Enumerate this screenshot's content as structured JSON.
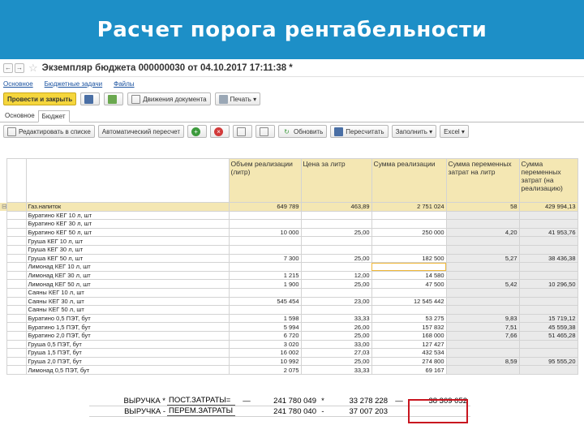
{
  "slide": {
    "title": "Расчет порога рентабельности"
  },
  "window": {
    "title": "Экземпляр бюджета 000000030 от 04.10.2017 17:11:38 *",
    "links": [
      "Основное",
      "Бюджетные задачи",
      "Файлы"
    ],
    "toolbar": {
      "post_close": "Провести и закрыть",
      "drive_docs": "Движения документа",
      "print": "Печать"
    },
    "tabs": [
      "Основное",
      "Бюджет"
    ],
    "grid_toolbar": {
      "edit_list": "Редактировать в списке",
      "auto_recalc": "Автоматический пересчет",
      "refresh": "Обновить",
      "recalc": "Пересчитать",
      "fill": "Заполнить",
      "excel": "Excel"
    }
  },
  "table": {
    "columns": [
      "",
      "Объем реализации (литр)",
      "Цена за литр",
      "Сумма реализации",
      "Сумма переменных затрат на литр",
      "Сумма переменных затрат (на реализацию)"
    ],
    "rows": [
      {
        "name": "Газ.напиток",
        "vol": "649 789",
        "price": "463,89",
        "sum": "2 751 024",
        "var_per": "58",
        "var_total": "429 994,13",
        "group": true
      },
      {
        "name": "Буратино КЕГ 10 л, шт",
        "vol": "",
        "price": "",
        "sum": "",
        "var_per": "",
        "var_total": ""
      },
      {
        "name": "Буратино КЕГ 30 л, шт",
        "vol": "",
        "price": "",
        "sum": "",
        "var_per": "",
        "var_total": ""
      },
      {
        "name": "Буратино КЕГ 50 л, шт",
        "vol": "10 000",
        "price": "25,00",
        "sum": "250 000",
        "var_per": "4,20",
        "var_total": "41 953,76"
      },
      {
        "name": "Груша КЕГ 10 л, шт",
        "vol": "",
        "price": "",
        "sum": "",
        "var_per": "",
        "var_total": ""
      },
      {
        "name": "Груша КЕГ 30 л, шт",
        "vol": "",
        "price": "",
        "sum": "",
        "var_per": "",
        "var_total": ""
      },
      {
        "name": "Груша КЕГ 50 л, шт",
        "vol": "7 300",
        "price": "25,00",
        "sum": "182 500",
        "var_per": "5,27",
        "var_total": "38 436,38"
      },
      {
        "name": "Лимонад КЕГ 10 л, шт",
        "vol": "",
        "price": "",
        "sum": "",
        "var_per": "",
        "var_total": "",
        "sel": true
      },
      {
        "name": "Лимонад КЕГ 30 л, шт",
        "vol": "1 215",
        "price": "12,00",
        "sum": "14 580",
        "var_per": "",
        "var_total": ""
      },
      {
        "name": "Лимонад КЕГ 50 л, шт",
        "vol": "1 900",
        "price": "25,00",
        "sum": "47 500",
        "var_per": "5,42",
        "var_total": "10 296,50"
      },
      {
        "name": "Саяны КЕГ 10 л, шт",
        "vol": "",
        "price": "",
        "sum": "",
        "var_per": "",
        "var_total": ""
      },
      {
        "name": "Саяны КЕГ 30 л, шт",
        "vol": "545 454",
        "price": "23,00",
        "sum": "12 545 442",
        "var_per": "",
        "var_total": ""
      },
      {
        "name": "Саяны КЕГ 50 л, шт",
        "vol": "",
        "price": "",
        "sum": "",
        "var_per": "",
        "var_total": ""
      },
      {
        "name": "Буратино 0,5 ПЭТ, бут",
        "vol": "1 598",
        "price": "33,33",
        "sum": "53 275",
        "var_per": "9,83",
        "var_total": "15 719,12"
      },
      {
        "name": "Буратино 1,5 ПЭТ, бут",
        "vol": "5 994",
        "price": "26,00",
        "sum": "157 832",
        "var_per": "7,51",
        "var_total": "45 559,38"
      },
      {
        "name": "Буратино 2,0 ПЭТ, бут",
        "vol": "6 720",
        "price": "25,00",
        "sum": "168 000",
        "var_per": "7,66",
        "var_total": "51 465,28"
      },
      {
        "name": "Груша 0,5 ПЭТ, бут",
        "vol": "3 020",
        "price": "33,00",
        "sum": "127 427",
        "var_per": "",
        "var_total": ""
      },
      {
        "name": "Груша 1,5 ПЭТ, бут",
        "vol": "16 002",
        "price": "27,03",
        "sum": "432 534",
        "var_per": "",
        "var_total": ""
      },
      {
        "name": "Груша 2,0 ПЭТ, бут",
        "vol": "10 992",
        "price": "25,00",
        "sum": "274 800",
        "var_per": "8,59",
        "var_total": "95 555,20"
      },
      {
        "name": "Лимонад 0,5 ПЭТ, бут",
        "vol": "2 075",
        "price": "33,33",
        "sum": "69 167",
        "var_per": "",
        "var_total": ""
      }
    ]
  },
  "summary": [
    {
      "label": "ВЫРУЧКА *",
      "label2": "ПОСТ.ЗАТРАТЫ=",
      "dash1": "—",
      "v1": "241 780 049",
      "op": "*",
      "v2": "33 278 228",
      "dash2": "—",
      "result": "38 309 052"
    },
    {
      "label": "ВЫРУЧКА -",
      "label2": "ПЕРЕМ.ЗАТРАТЫ",
      "dash1": "",
      "v1": "241 780 040",
      "op": "-",
      "v2": "37 007 203",
      "dash2": "",
      "result": ""
    }
  ]
}
